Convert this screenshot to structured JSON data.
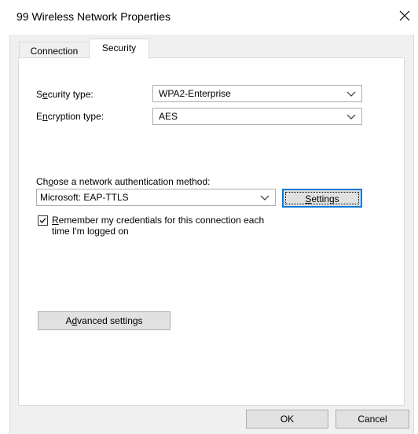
{
  "window": {
    "title": "99 Wireless Network Properties"
  },
  "tabs": [
    {
      "label": "Connection"
    },
    {
      "label": "Security"
    }
  ],
  "security": {
    "security_type_label": "Security type:",
    "security_type_value": "WPA2-Enterprise",
    "encryption_type_label": "Encryption type:",
    "encryption_type_value": "AES",
    "auth_method_label": "Choose a network authentication method:",
    "auth_method_value": "Microsoft: EAP-TTLS",
    "settings_button": "Settings",
    "remember_line1": "Remember my credentials for this connection each",
    "remember_line2": "time I'm logged on",
    "remember_checked": true,
    "advanced_button": "Advanced settings"
  },
  "footer": {
    "ok": "OK",
    "cancel": "Cancel"
  },
  "icons": {
    "close": "close-icon",
    "chevron": "chevron-down-icon",
    "check": "checkmark-icon"
  },
  "colors": {
    "accent": "#0078d7",
    "face": "#f0f0f0",
    "button": "#e1e1e1"
  }
}
